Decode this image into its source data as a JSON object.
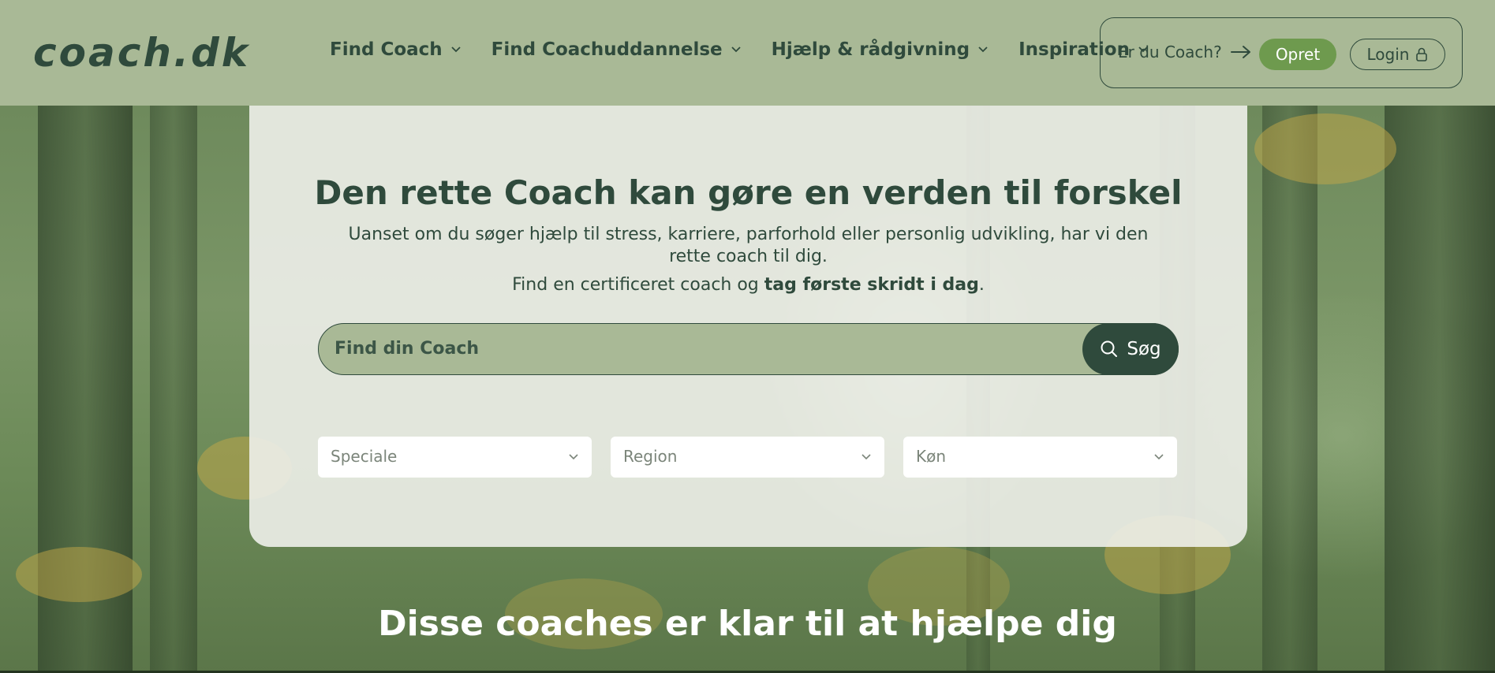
{
  "header": {
    "logo": "coach.dk",
    "nav": [
      {
        "label": "Find Coach"
      },
      {
        "label": "Find Coachuddannelse"
      },
      {
        "label": "Hjælp & rådgivning"
      },
      {
        "label": "Inspiration"
      }
    ],
    "account": {
      "question": "Er du Coach?",
      "opret_label": "Opret",
      "login_label": "Login"
    }
  },
  "hero": {
    "title": "Den rette Coach kan gøre en verden til forskel",
    "subtitle": "Uanset om du søger hjælp til stress, karriere, parforhold eller personlig udvikling, har vi den rette coach til dig.",
    "cta_prefix": "Find en certificeret coach og ",
    "cta_bold": "tag første skridt i dag",
    "cta_suffix": ".",
    "search": {
      "placeholder": "Find din Coach",
      "value": "",
      "button_label": "Søg"
    },
    "filters": [
      {
        "label": "Speciale"
      },
      {
        "label": "Region"
      },
      {
        "label": "Køn"
      }
    ]
  },
  "section": {
    "coaches_title": "Disse coaches er klar til at hjælpe dig"
  },
  "colors": {
    "header_bg": "#a9b996",
    "primary_dark": "#2f4a3c",
    "accent_green": "#6e9a4e",
    "card_bg": "#eef0ea"
  },
  "icons": {
    "nav_chevron": "chevron-down-icon",
    "arrow": "arrow-right-icon",
    "lock": "lock-icon",
    "search": "search-icon"
  }
}
